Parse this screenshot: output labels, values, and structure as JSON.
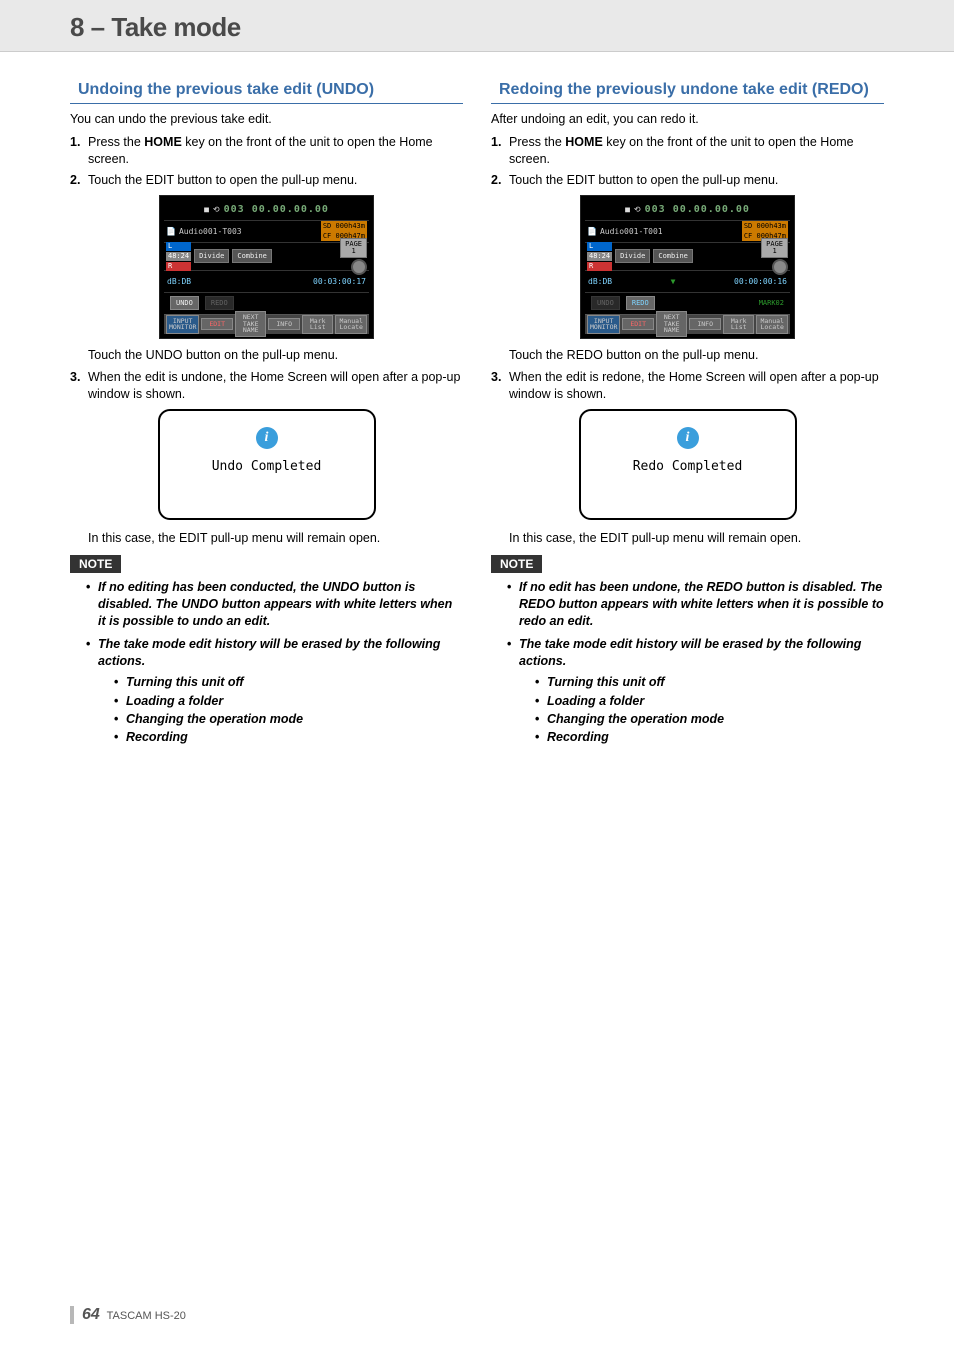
{
  "header": {
    "chapter_title": "8 – Take mode"
  },
  "undo": {
    "heading": "Undoing the previous take edit (UNDO)",
    "intro": "You can undo the previous take edit.",
    "steps": {
      "s1_num": "1",
      "s1_a": "Press the ",
      "s1_bold": "HOME",
      "s1_b": " key on the front of the unit to open the Home screen.",
      "s2_num": "2",
      "s2": "Touch the EDIT button to open the pull-up menu.",
      "after_fig": "Touch the UNDO button on the pull-up menu.",
      "s3_num": "3",
      "s3": "When the edit is undone, the Home Screen will open after a pop-up window is shown.",
      "popup": "Undo Completed",
      "after_popup": "In this case, the EDIT pull-up menu will remain open."
    },
    "screen": {
      "time": "003 00.00.00.00",
      "file": "Audio001-T003",
      "sd": "SD  000h43m",
      "cf": "CF  000h47m",
      "divide": "Divide",
      "combine": "Combine",
      "page": "PAGE\n1",
      "db": "dB:DB",
      "tc": "00:03:00:17",
      "undo": "UNDO",
      "redo": "REDO",
      "b_monitor": "INPUT\nMONITOR",
      "b_edit": "EDIT",
      "b_name": "NEXT\nTAKE\nNAME",
      "b_info": "INFO",
      "b_mark": "Mark\nList",
      "b_locate": "Manual\nLocate"
    },
    "note": {
      "label": "NOTE",
      "n1": "If no editing has been conducted, the UNDO button is disabled. The UNDO button appears with white letters when it is possible to undo an edit.",
      "n2": "The take mode edit history will be erased by the following actions.",
      "sub1": "Turning this unit off",
      "sub2": "Loading a folder",
      "sub3": "Changing the operation mode",
      "sub4": "Recording"
    }
  },
  "redo": {
    "heading": "Redoing the previously undone take edit (REDO)",
    "intro": "After undoing an edit, you can redo it.",
    "steps": {
      "s1_num": "1",
      "s1_a": "Press the ",
      "s1_bold": "HOME",
      "s1_b": " key on the front of the unit to open the Home screen.",
      "s2_num": "2",
      "s2": "Touch the EDIT button to open the pull-up menu.",
      "after_fig": "Touch the REDO button on the pull-up menu.",
      "s3_num": "3",
      "s3": "When the edit is redone, the Home Screen will open after a pop-up window is shown.",
      "popup": "Redo Completed",
      "after_popup": "In this case, the EDIT pull-up menu will remain open."
    },
    "screen": {
      "time": "003 00.00.00.00",
      "file": "Audio001-T001",
      "sd": "SD  000h43m",
      "cf": "CF  000h47m",
      "divide": "Divide",
      "combine": "Combine",
      "page": "PAGE\n1",
      "db": "dB:DB",
      "tc": "00:00:00:16",
      "undo": "UNDO",
      "redo": "REDO",
      "mark": "MARK02",
      "b_monitor": "INPUT\nMONITOR",
      "b_edit": "EDIT",
      "b_name": "NEXT\nTAKE\nNAME",
      "b_info": "INFO",
      "b_mark": "Mark\nList",
      "b_locate": "Manual\nLocate"
    },
    "note": {
      "label": "NOTE",
      "n1": "If no edit has been undone, the REDO button is disabled. The REDO button appears with white letters when it is possible to redo an edit.",
      "n2": "The take mode edit history will be erased by the following actions.",
      "sub1": "Turning this unit off",
      "sub2": "Loading a folder",
      "sub3": "Changing the operation mode",
      "sub4": "Recording"
    }
  },
  "footer": {
    "page": "64",
    "product": "TASCAM HS-20"
  }
}
